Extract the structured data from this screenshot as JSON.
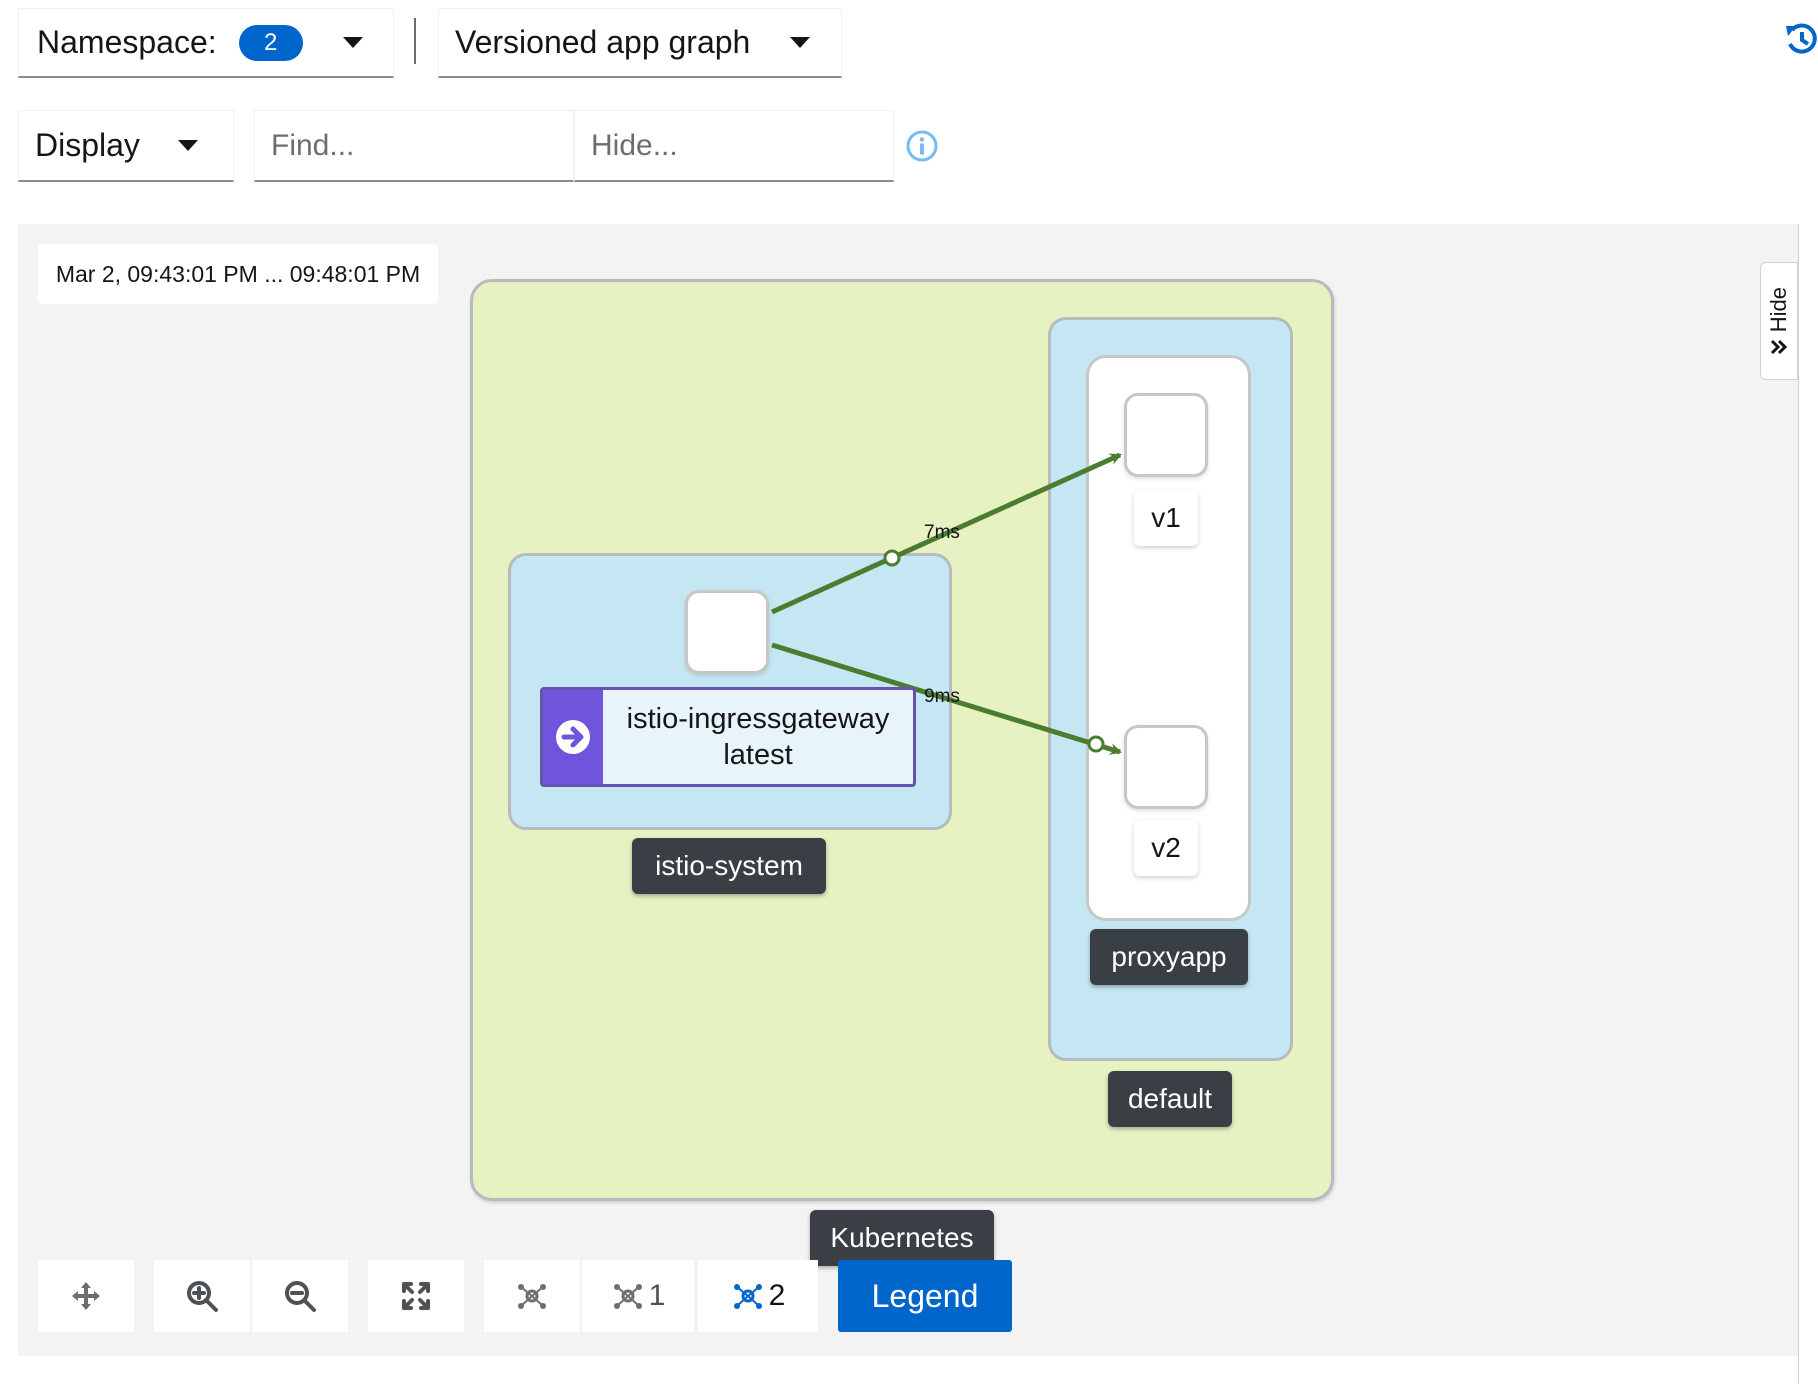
{
  "toolbar": {
    "namespace_label": "Namespace:",
    "namespace_count": "2",
    "graph_type": "Versioned app graph",
    "display_label": "Display",
    "find_placeholder": "Find...",
    "hide_placeholder": "Hide..."
  },
  "graph": {
    "timestamp": "Mar 2, 09:43:01 PM ... 09:48:01 PM",
    "cluster_label": "Kubernetes",
    "namespaces": {
      "istio_system": "istio-system",
      "default": "default"
    },
    "app_box_label": "proxyapp",
    "gateway_node": {
      "name": "istio-ingressgateway",
      "version": "latest"
    },
    "version_nodes": [
      "v1",
      "v2"
    ],
    "edges": [
      {
        "from": "istio-ingressgateway",
        "to": "v1",
        "label": "7ms"
      },
      {
        "from": "istio-ingressgateway",
        "to": "v2",
        "label": "9ms"
      }
    ],
    "edge_color": "#4b7c2f"
  },
  "controls": {
    "layout1_label": "1",
    "layout2_label": "2",
    "legend_label": "Legend"
  },
  "side_panel": {
    "hide_label": "Hide"
  },
  "colors": {
    "accent": "#0066cc",
    "cluster_fill": "#e7f2c3",
    "namespace_fill": "#c5e7f3",
    "gateway_purple": "#6e55dc"
  }
}
